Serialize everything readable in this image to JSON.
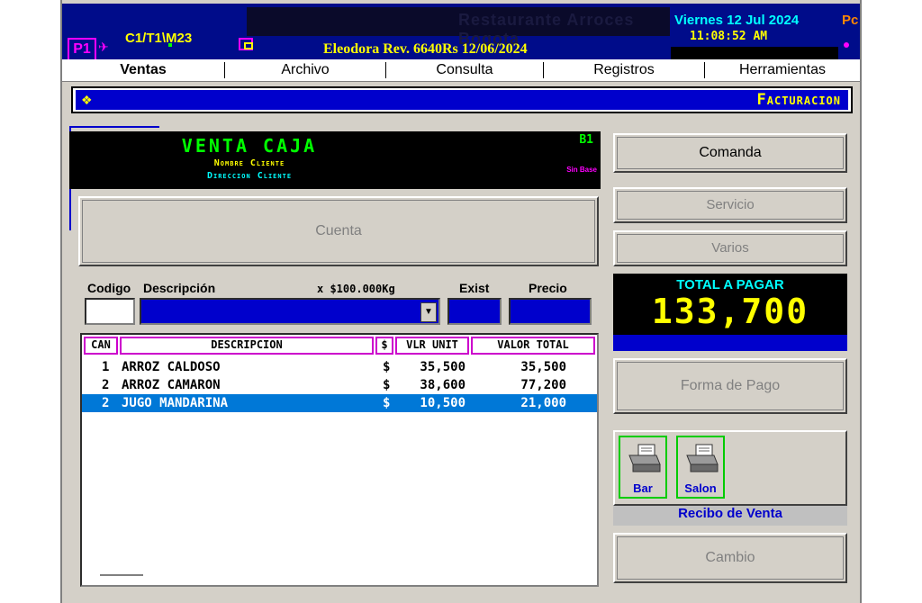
{
  "header": {
    "ghost_title": "Restaurante Arroces Bogota",
    "terminal_badge": "P1",
    "terminal_code": "C1/T1\\M23",
    "version": "Eleodora Rev. 6640Rs 12/06/2024",
    "date": "Viernes 12 Jul 2024",
    "time": "11:08:52 AM",
    "pc_label": "Pc"
  },
  "menu": {
    "items": [
      "Ventas",
      "Archivo",
      "Consulta",
      "Registros",
      "Herramientas"
    ]
  },
  "section": {
    "title": "Facturacion",
    "icon": "diamond-icon"
  },
  "venta": {
    "title": "VENTA CAJA",
    "cliente_nombre": "Nombre Cliente",
    "cliente_direccion": "Direccion Cliente",
    "mesa": "B1",
    "sin_base": "Sin Base"
  },
  "buttons": {
    "cuenta": "Cuenta",
    "comanda": "Comanda",
    "servicio": "Servicio",
    "varios": "Varios",
    "forma_pago": "Forma de Pago",
    "cambio": "Cambio"
  },
  "entry": {
    "codigo_label": "Codigo",
    "descripcion_label": "Descripción",
    "unidad_label": "x $100.000Kg",
    "exist_label": "Exist",
    "precio_label": "Precio",
    "codigo_value": ""
  },
  "table": {
    "headers": [
      "CAN",
      "DESCRIPCION",
      "$",
      "VLR UNIT",
      "VALOR TOTAL"
    ],
    "rows": [
      {
        "can": "1",
        "desc": "ARROZ CALDOSO",
        "cur": "$",
        "unit": "35,500",
        "total": "35,500"
      },
      {
        "can": "2",
        "desc": "ARROZ CAMARON",
        "cur": "$",
        "unit": "38,600",
        "total": "77,200"
      },
      {
        "can": "2",
        "desc": "JUGO MANDARINA",
        "cur": "$",
        "unit": "10,500",
        "total": "21,000"
      }
    ],
    "selected_row": 2
  },
  "total": {
    "label": "TOTAL A PAGAR",
    "value": "133,700"
  },
  "printers": {
    "items": [
      {
        "label": "Bar",
        "icon": "printer-icon"
      },
      {
        "label": "Salon",
        "icon": "printer-icon"
      }
    ],
    "recibo_label": "Recibo de Venta"
  },
  "colors": {
    "title_bg": "#000c8a",
    "section_bg": "#0000cc",
    "accent_yellow": "#ffff00",
    "accent_cyan": "#00ffff",
    "accent_green": "#00ff00",
    "accent_magenta": "#ff00ff",
    "selection": "#0078d7"
  }
}
